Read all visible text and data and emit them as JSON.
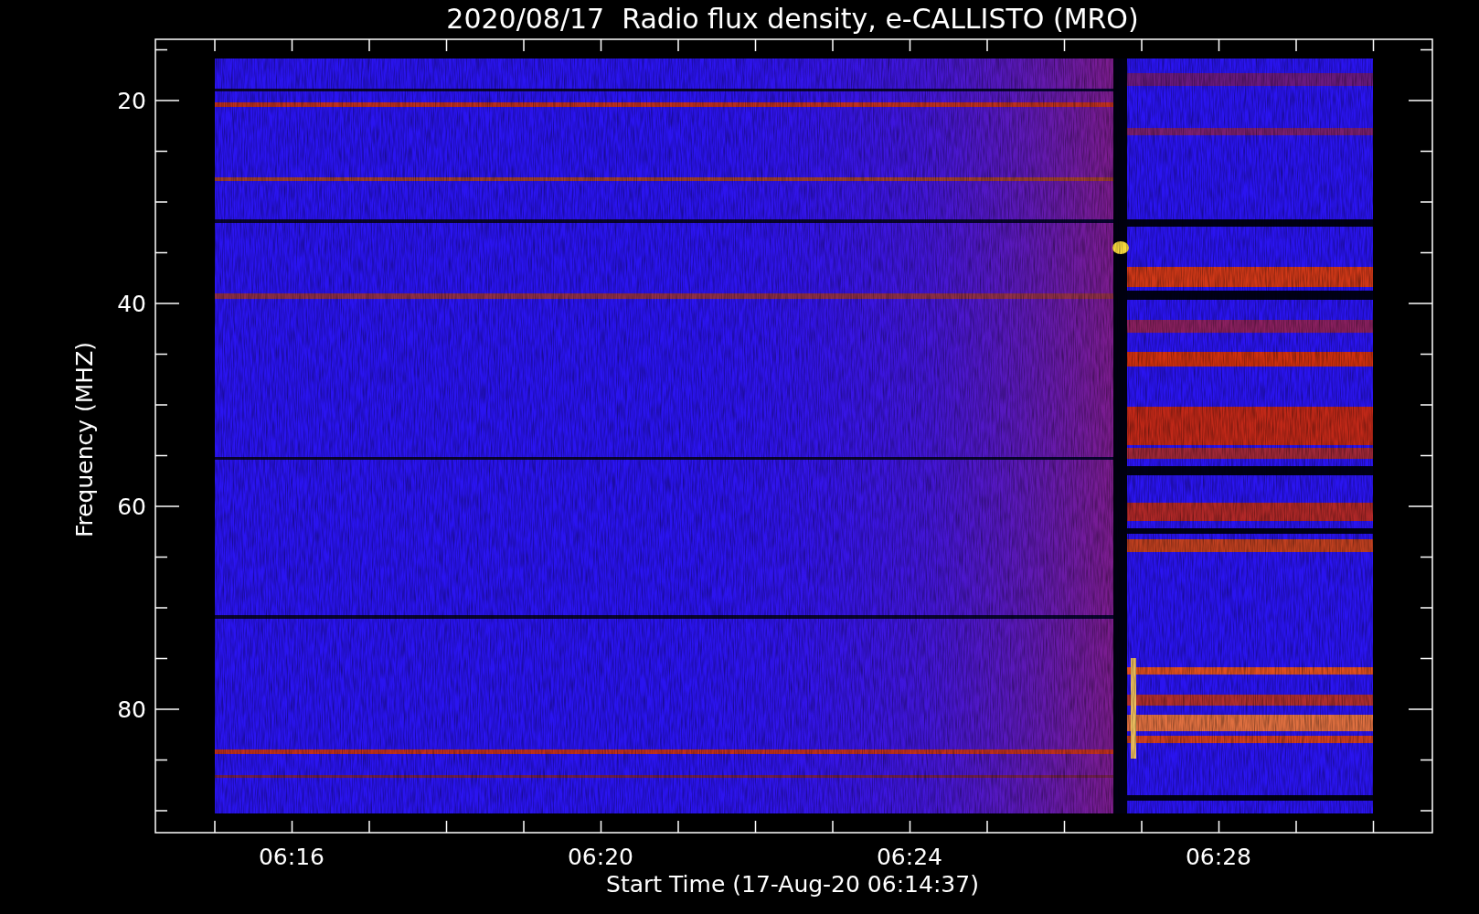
{
  "title": "2020/08/17  Radio flux density, e-CALLISTO (MRO)",
  "y_axis": {
    "title": "Frequency (MHZ)",
    "ticks": [
      "20",
      "40",
      "60",
      "80"
    ]
  },
  "x_axis": {
    "title": "Start Time (17-Aug-20 06:14:37)",
    "ticks": [
      "06:16",
      "06:20",
      "06:24",
      "06:28"
    ]
  }
}
